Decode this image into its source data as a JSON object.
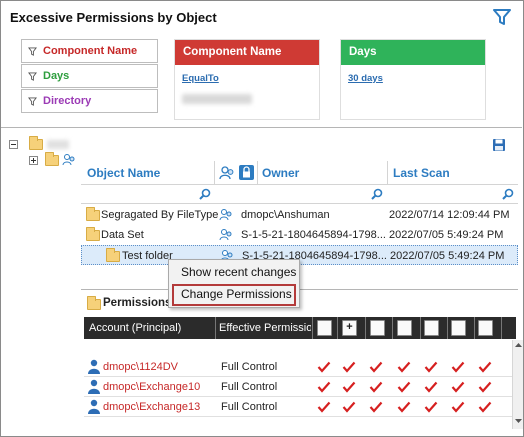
{
  "header": {
    "title": "Excessive Permissions by Object"
  },
  "filters": [
    {
      "label": "Component Name",
      "color": "#c62828"
    },
    {
      "label": "Days",
      "color": "#2e9e3e"
    },
    {
      "label": "Directory",
      "color": "#9b3ab5"
    }
  ],
  "cards": [
    {
      "title": "Component Name",
      "color": "#cf3a34",
      "link": "EqualTo"
    },
    {
      "title": "Days",
      "color": "#2fb35a",
      "link": "30 days"
    }
  ],
  "grid": {
    "columns": [
      "Object Name",
      "Owner",
      "Last Scan"
    ],
    "rows": [
      {
        "name": "Segragated By FileType",
        "owner": "dmopc\\Anshuman",
        "scan": "2022/07/14 12:09:44 PM"
      },
      {
        "name": "Data Set",
        "owner": "S-1-5-21-1804645894-1798...",
        "scan": "2022/07/05 5:49:24 PM"
      },
      {
        "name": "Test folder",
        "owner": "S-1-5-21-1804645894-1798...",
        "scan": "2022/07/05 5:49:24 PM"
      }
    ]
  },
  "context_menu": {
    "items": [
      "Show recent changes",
      "Change Permissions"
    ]
  },
  "permissions": {
    "title": "Permissions",
    "columns": [
      "Account (Principal)",
      "Effective Permissio"
    ],
    "rows": [
      {
        "account": "dmopc\\1124DV",
        "effective": "Full Control"
      },
      {
        "account": "dmopc\\Exchange10",
        "effective": "Full Control"
      },
      {
        "account": "dmopc\\Exchange13",
        "effective": "Full Control"
      }
    ]
  },
  "colors": {
    "accent": "#2d7cc1",
    "check": "#d62020",
    "highlight": "#b33a3a"
  }
}
